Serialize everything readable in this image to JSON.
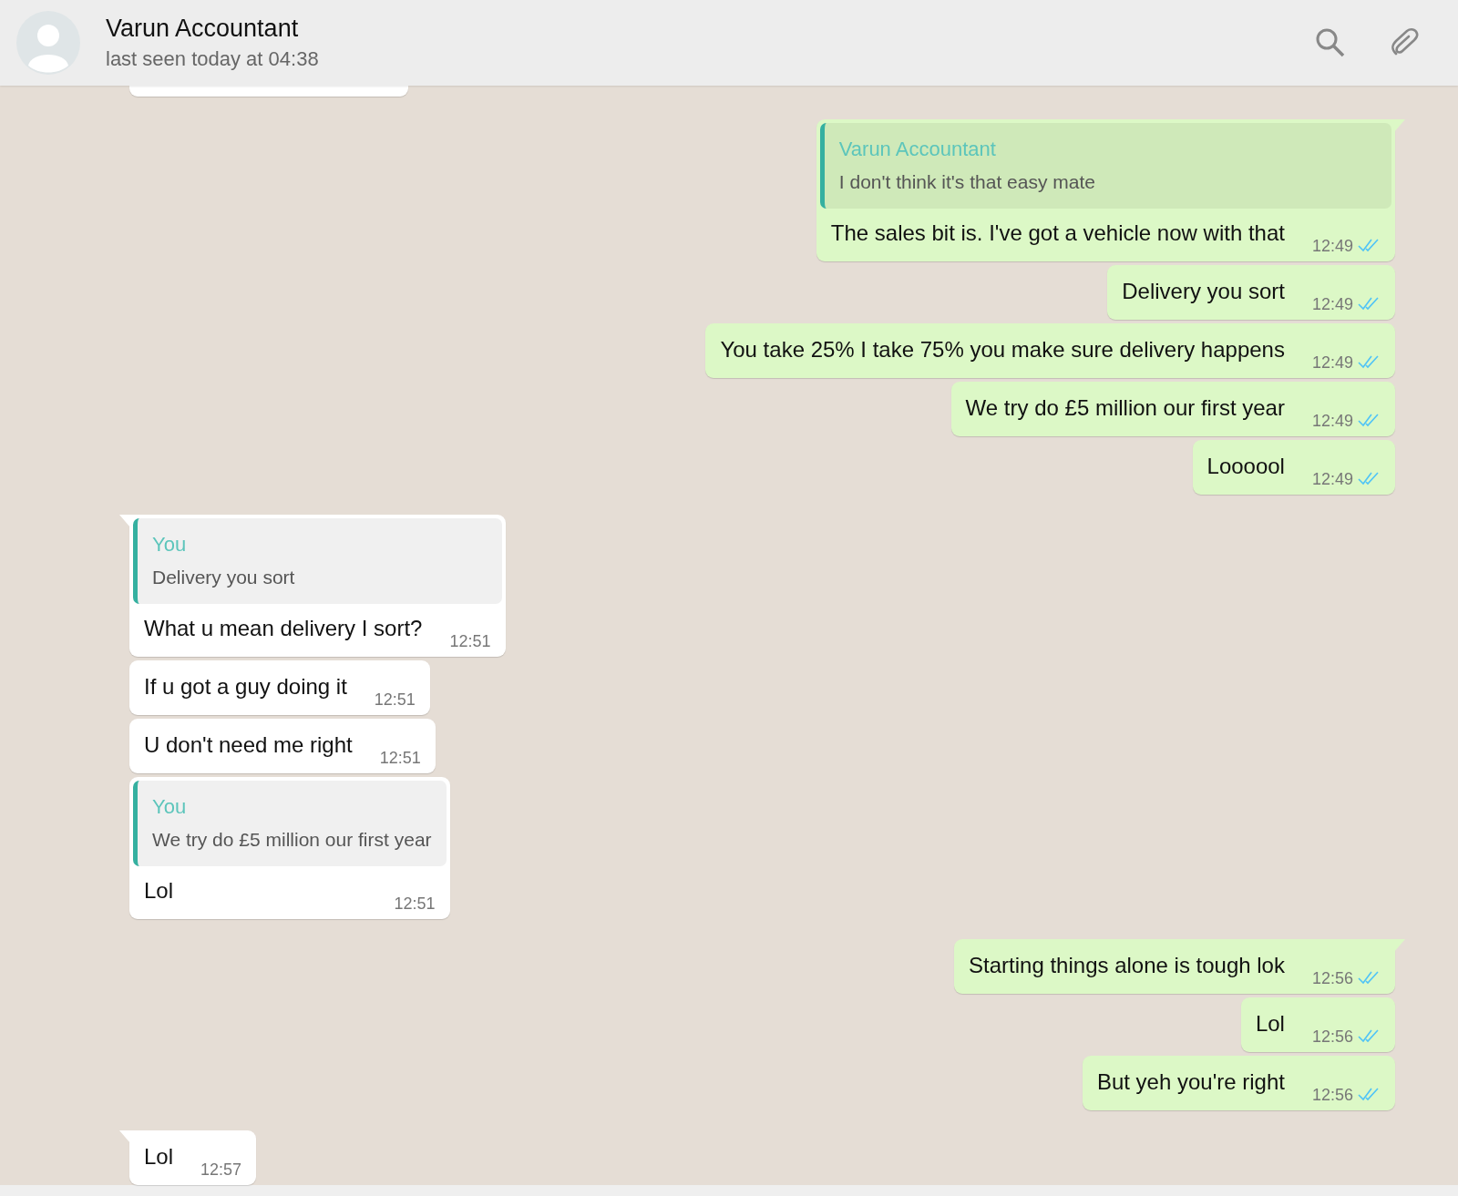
{
  "header": {
    "name": "Varun Accountant",
    "status": "last seen today at 04:38"
  },
  "messages": [
    {
      "kind": "sent",
      "tail": true,
      "quote": {
        "author": "Varun Accountant",
        "text": "I don't think it's that easy mate"
      },
      "text": "The sales bit is. I've got a vehicle now with that",
      "time": "12:49",
      "read": true
    },
    {
      "kind": "sent",
      "tail": false,
      "text": "Delivery you sort",
      "time": "12:49",
      "read": true
    },
    {
      "kind": "sent",
      "tail": false,
      "text": "You take 25% I take 75% you make sure delivery happens",
      "time": "12:49",
      "read": true
    },
    {
      "kind": "sent",
      "tail": false,
      "text": "We try do £5 million our first year",
      "time": "12:49",
      "read": true
    },
    {
      "kind": "sent",
      "tail": false,
      "text": "Loooool",
      "time": "12:49",
      "read": true
    },
    {
      "kind": "received",
      "tail": true,
      "quote": {
        "author": "You",
        "text": "Delivery you sort"
      },
      "text": "What u mean delivery I sort?",
      "time": "12:51"
    },
    {
      "kind": "received",
      "tail": false,
      "text": "If u got a guy doing it",
      "time": "12:51"
    },
    {
      "kind": "received",
      "tail": false,
      "text": "U don't need me right",
      "time": "12:51"
    },
    {
      "kind": "received",
      "tail": false,
      "quote": {
        "author": "You",
        "text": "We try do £5 million our first year"
      },
      "text": "Lol",
      "time": "12:51"
    },
    {
      "kind": "sent",
      "tail": true,
      "text": "Starting things alone is tough lok",
      "time": "12:56",
      "read": true
    },
    {
      "kind": "sent",
      "tail": false,
      "text": "Lol",
      "time": "12:56",
      "read": true
    },
    {
      "kind": "sent",
      "tail": false,
      "text": "But yeh you're right",
      "time": "12:56",
      "read": true
    },
    {
      "kind": "received",
      "tail": true,
      "text": "Lol",
      "time": "12:57"
    }
  ]
}
